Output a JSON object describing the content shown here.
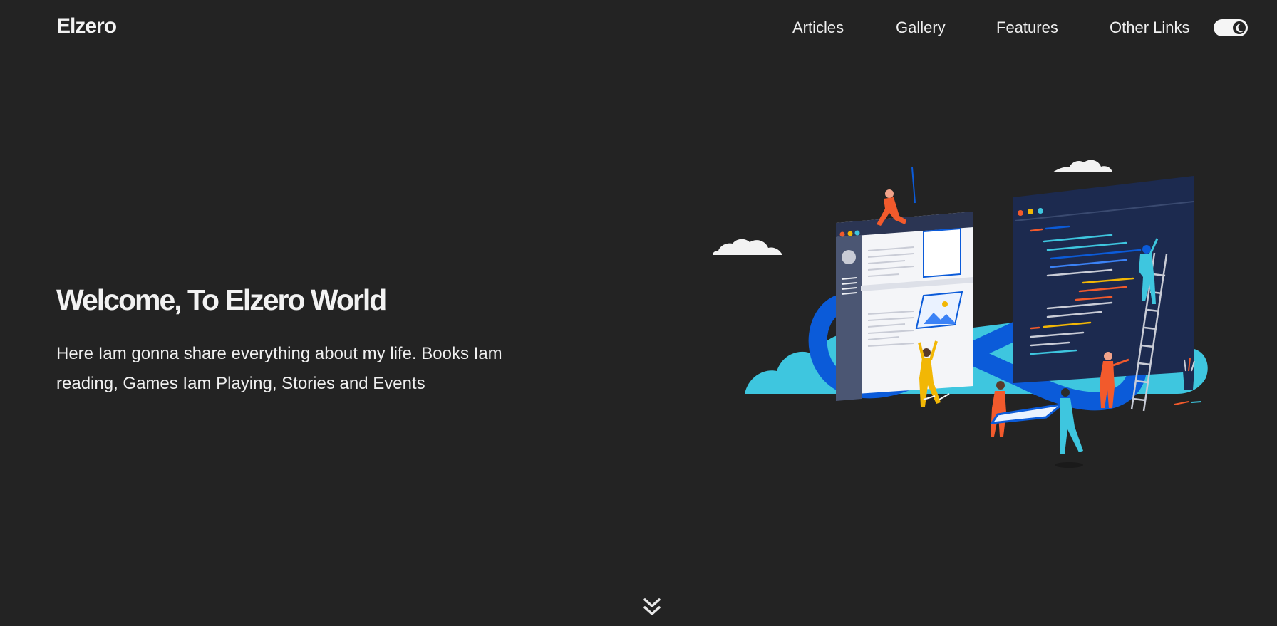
{
  "header": {
    "logo": "Elzero",
    "nav": [
      {
        "label": "Articles"
      },
      {
        "label": "Gallery"
      },
      {
        "label": "Features"
      },
      {
        "label": "Other Links"
      }
    ],
    "theme_toggle": {
      "state": "dark",
      "icon": "moon-icon"
    }
  },
  "hero": {
    "title": "Welcome, To Elzero World",
    "description": "Here Iam gonna share everything about my life. Books Iam reading, Games Iam Playing, Stories and Events"
  },
  "scroll_indicator": {
    "icon": "double-chevron-down-icon"
  },
  "colors": {
    "background": "#232323",
    "text": "#f0f0f0",
    "illustration_blue": "#0b5bd9",
    "illustration_cyan": "#3ec6df",
    "illustration_navy": "#1c2a4f",
    "illustration_orange": "#f25a2c",
    "illustration_yellow": "#f2b705"
  }
}
